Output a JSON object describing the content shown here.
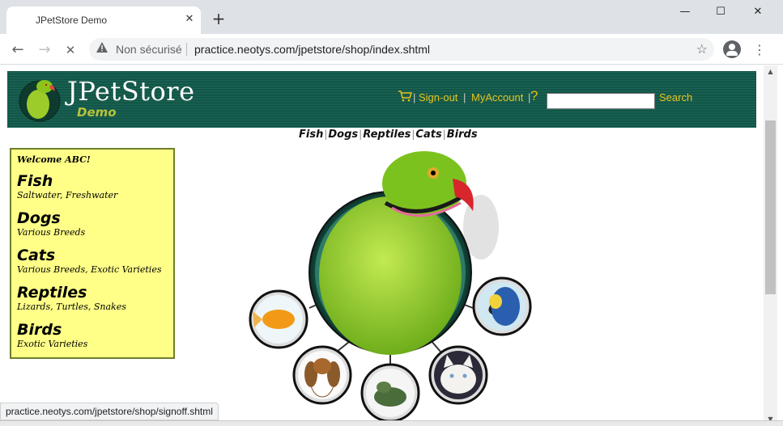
{
  "browser": {
    "tab_title": "JPetStore Demo",
    "tab_close": "✕",
    "new_tab": "+",
    "window_controls": {
      "minimize": "—",
      "maximize": "☐",
      "close": "✕"
    },
    "nav": {
      "back": "←",
      "forward": "→",
      "stop": "✕"
    },
    "security_label": "Non sécurisé",
    "url": "practice.neotys.com/jpetstore/shop/index.shtml",
    "star": "☆",
    "menu": "⋮",
    "status_url": "practice.neotys.com/jpetstore/shop/signoff.shtml"
  },
  "header": {
    "title": "JPetStore",
    "subtitle": "Demo",
    "sign_out": "Sign-out",
    "my_account": "MyAccount",
    "help": "?",
    "separator": "|",
    "search_value": "",
    "search_label": "Search",
    "background_color": "#0d4a3e",
    "link_color": "#e6c31b"
  },
  "quicklinks": [
    "Fish",
    "Dogs",
    "Reptiles",
    "Cats",
    "Birds"
  ],
  "sidebar": {
    "welcome": "Welcome ABC!",
    "background_color": "#ffff88",
    "categories": [
      {
        "name": "Fish",
        "desc": "Saltwater, Freshwater"
      },
      {
        "name": "Dogs",
        "desc": "Various Breeds"
      },
      {
        "name": "Cats",
        "desc": "Various Breeds, Exotic Varieties"
      },
      {
        "name": "Reptiles",
        "desc": "Lizards, Turtles, Snakes"
      },
      {
        "name": "Birds",
        "desc": "Exotic Varieties"
      }
    ]
  },
  "petmap": {
    "main_image": "parrot",
    "thumbnails": [
      "goldfish",
      "dog",
      "iguana",
      "cat",
      "macaw"
    ]
  }
}
